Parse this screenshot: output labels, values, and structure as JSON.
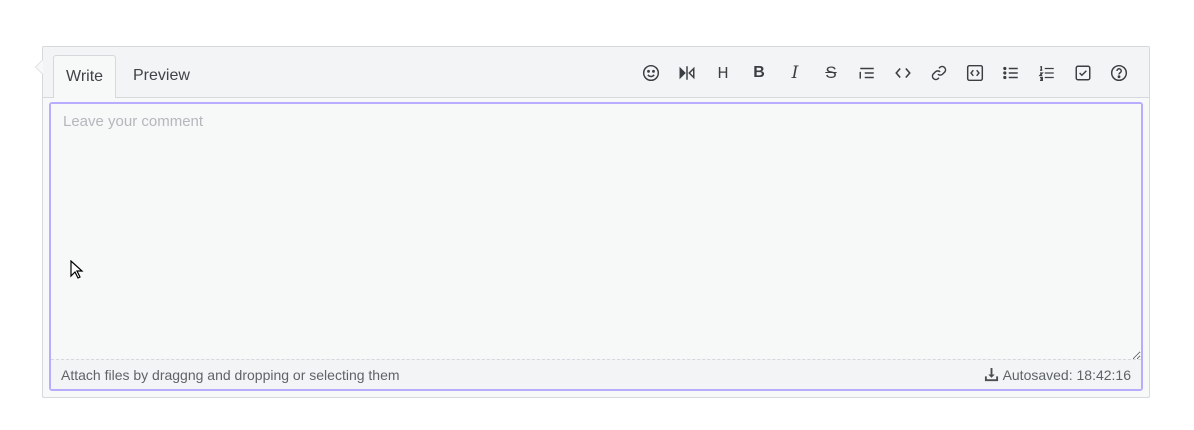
{
  "tabs": {
    "write": "Write",
    "preview": "Preview"
  },
  "toolbar": [
    "emoji-icon",
    "split-view-icon",
    "heading-icon",
    "bold-icon",
    "italic-icon",
    "strikethrough-icon",
    "quote-icon",
    "inline-code-icon",
    "link-icon",
    "code-block-icon",
    "bullet-list-icon",
    "numbered-list-icon",
    "task-list-icon",
    "help-icon"
  ],
  "toolbar_glyphs": {
    "heading": "H",
    "bold": "B",
    "italic": "I",
    "strike": "S"
  },
  "comment": {
    "placeholder": "Leave your comment",
    "value": ""
  },
  "footer": {
    "attach_text": "Attach files by draggng and dropping or selecting them",
    "autosave_text": "Autosaved: 18:42:16"
  },
  "colors": {
    "focus_border": "#b8acff",
    "background": "#f7f8f8",
    "border": "#d5d8dc"
  }
}
